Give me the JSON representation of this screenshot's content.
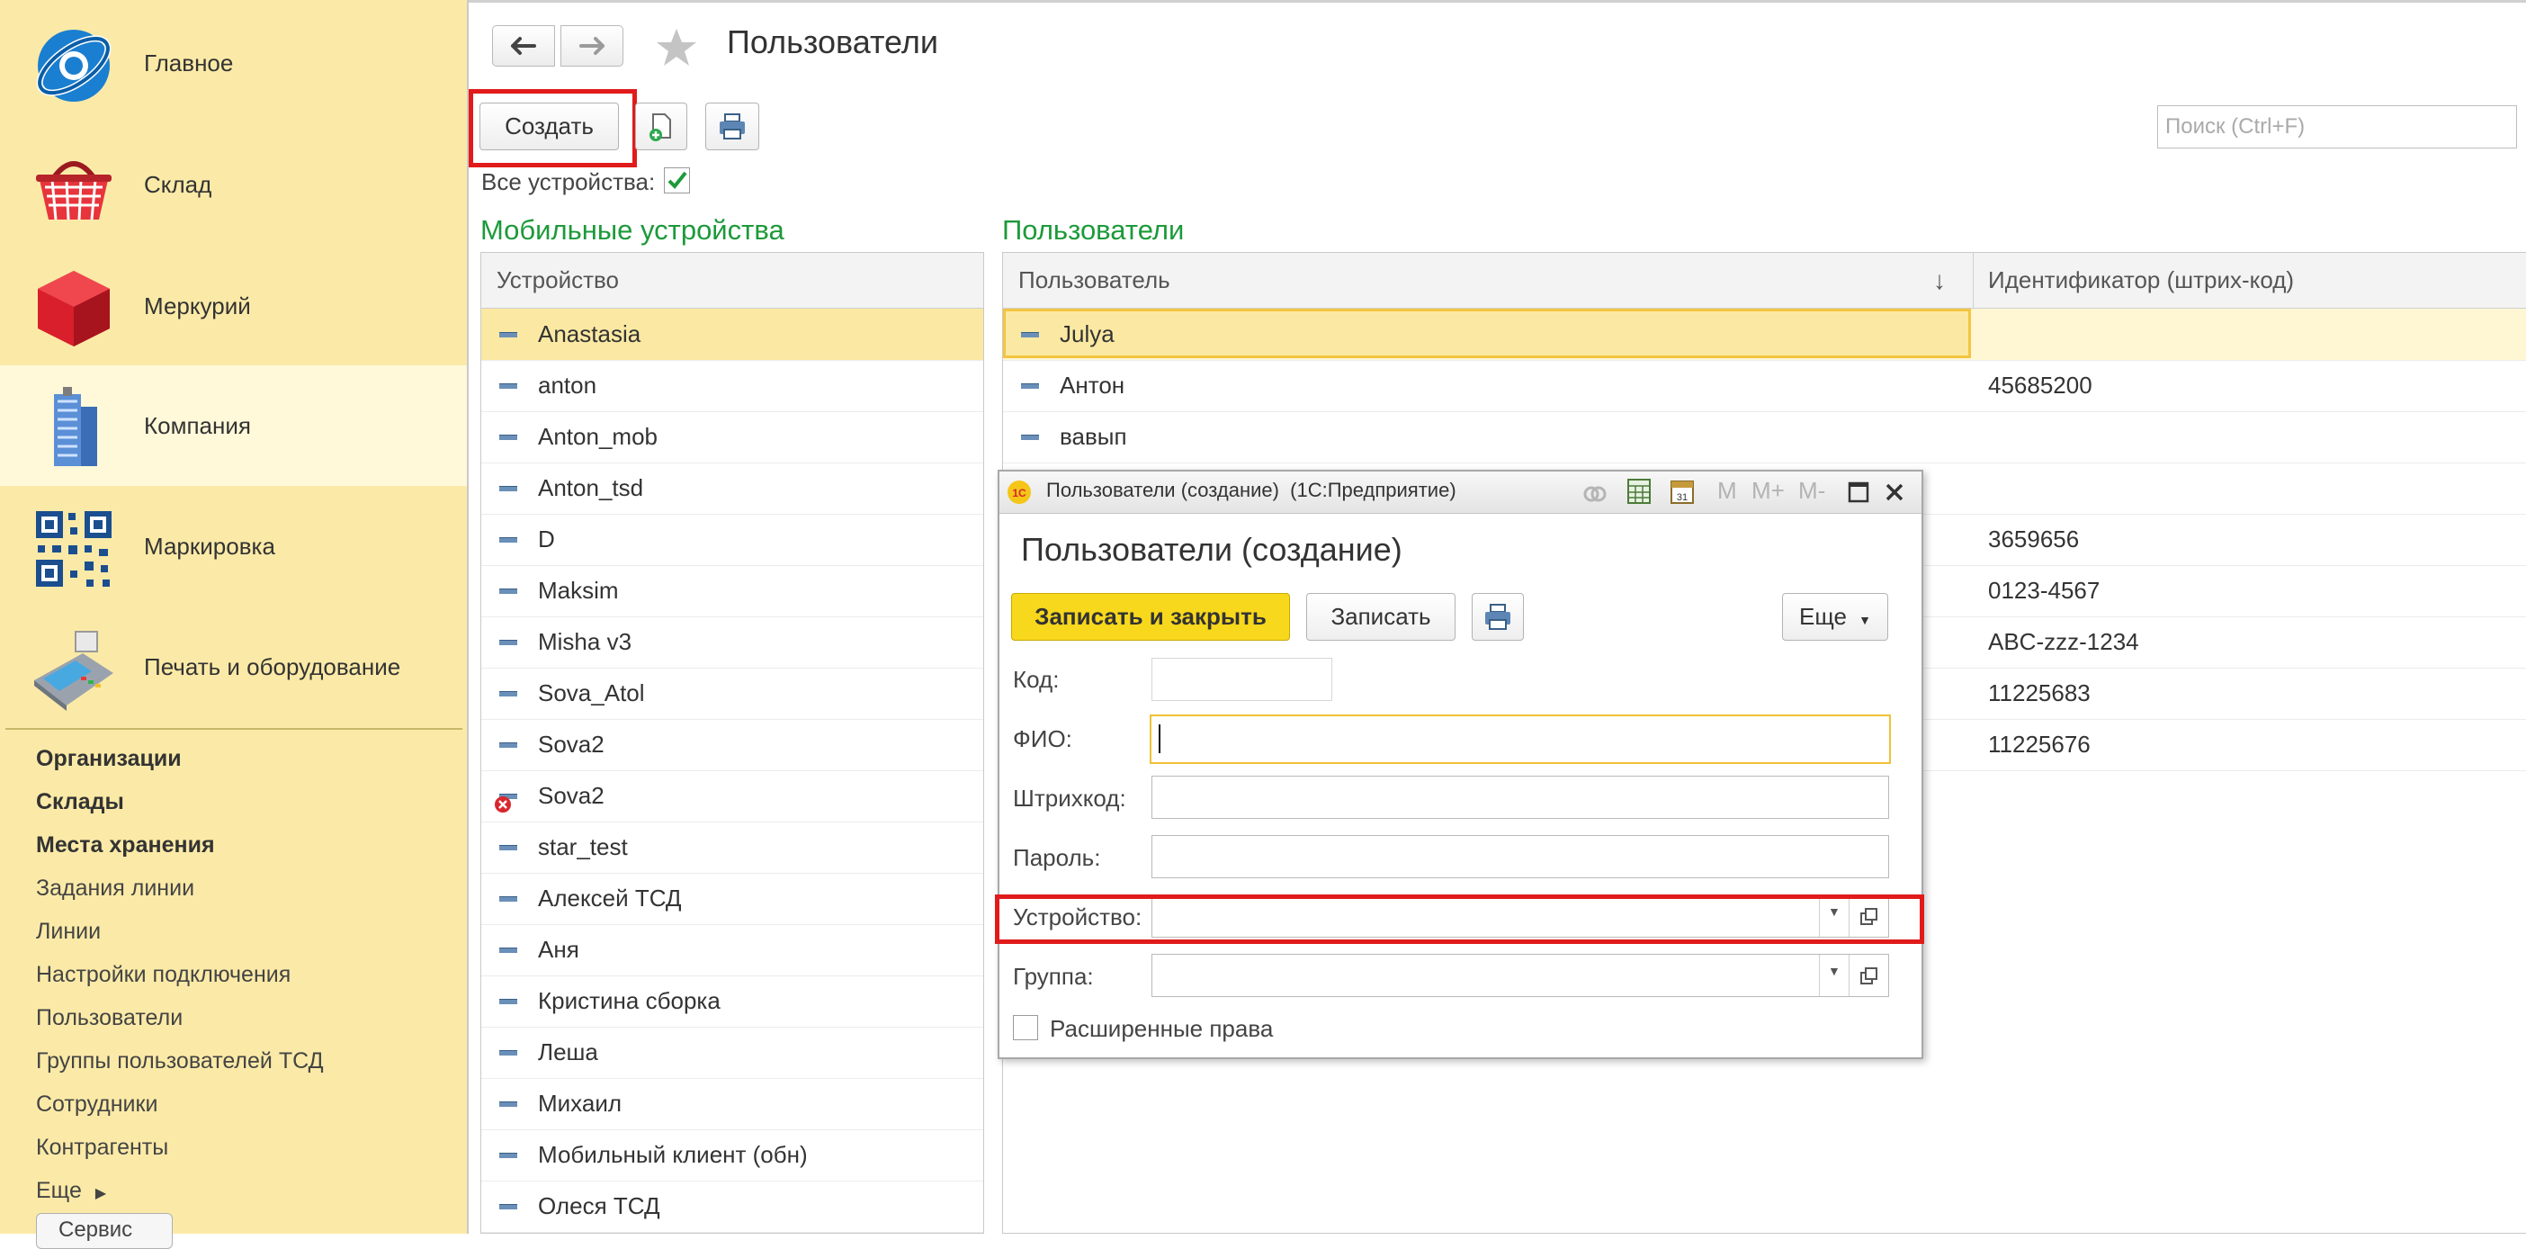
{
  "sidebar": {
    "sections": [
      {
        "label": "Главное",
        "icon": "globe-icon"
      },
      {
        "label": "Склад",
        "icon": "basket-icon"
      },
      {
        "label": "Меркурий",
        "icon": "cube-icon"
      },
      {
        "label": "Компания",
        "icon": "building-icon"
      },
      {
        "label": "Маркировка",
        "icon": "qr-code-icon"
      },
      {
        "label": "Печать и оборудование",
        "icon": "printer-terminal-icon"
      }
    ],
    "nav_bold": [
      "Организации",
      "Склады",
      "Места хранения"
    ],
    "nav": [
      "Задания линии",
      "Линии",
      "Настройки подключения",
      "Пользователи",
      "Группы пользователей ТСД",
      "Сотрудники",
      "Контрагенты",
      "Еще"
    ],
    "service_label": "Сервис"
  },
  "header": {
    "title": "Пользователи",
    "create_label": "Создать",
    "search_placeholder": "Поиск (Ctrl+F)",
    "all_devices_label": "Все устройства:"
  },
  "devices": {
    "heading": "Мобильные устройства",
    "column": "Устройство",
    "rows": [
      "Anastasia",
      "anton",
      "Anton_mob",
      "Anton_tsd",
      "D",
      "Maksim",
      "Misha v3",
      "Sova_Atol",
      "Sova2",
      "Sova2",
      "star_test",
      "Алексей ТСД",
      "Аня",
      "Кристина сборка",
      "Леша",
      "Михаил",
      "Мобильный клиент (обн)",
      "Олеся ТСД"
    ]
  },
  "users": {
    "heading": "Пользователи",
    "col_user": "Пользователь",
    "col_barcode": "Идентификатор (штрих-код)",
    "sort_indicator": "↓",
    "rows": [
      {
        "name": "Julya",
        "code": ""
      },
      {
        "name": "Антон",
        "code": "45685200"
      },
      {
        "name": "вавып",
        "code": ""
      },
      {
        "name": "",
        "code": ""
      },
      {
        "name": "",
        "code": "3659656"
      },
      {
        "name": "",
        "code": "0123-4567"
      },
      {
        "name": "",
        "code": "ABC-zzz-1234"
      },
      {
        "name": "",
        "code": "11225683"
      },
      {
        "name": "",
        "code": "11225676"
      }
    ]
  },
  "dialog": {
    "window_title": "Пользователи (создание)  (1С:Предприятие)",
    "heading": "Пользователи (создание)",
    "save_close_label": "Записать и закрыть",
    "save_label": "Записать",
    "more_label": "Еще",
    "code_label": "Код:",
    "fio_label": "ФИО:",
    "barcode_label": "Штрихкод:",
    "password_label": "Пароль:",
    "device_label": "Устройство:",
    "group_label": "Группа:",
    "extended_rights_label": "Расширенные права",
    "tb_m": "M",
    "tb_mplus": "M+",
    "tb_mminus": "M-"
  }
}
